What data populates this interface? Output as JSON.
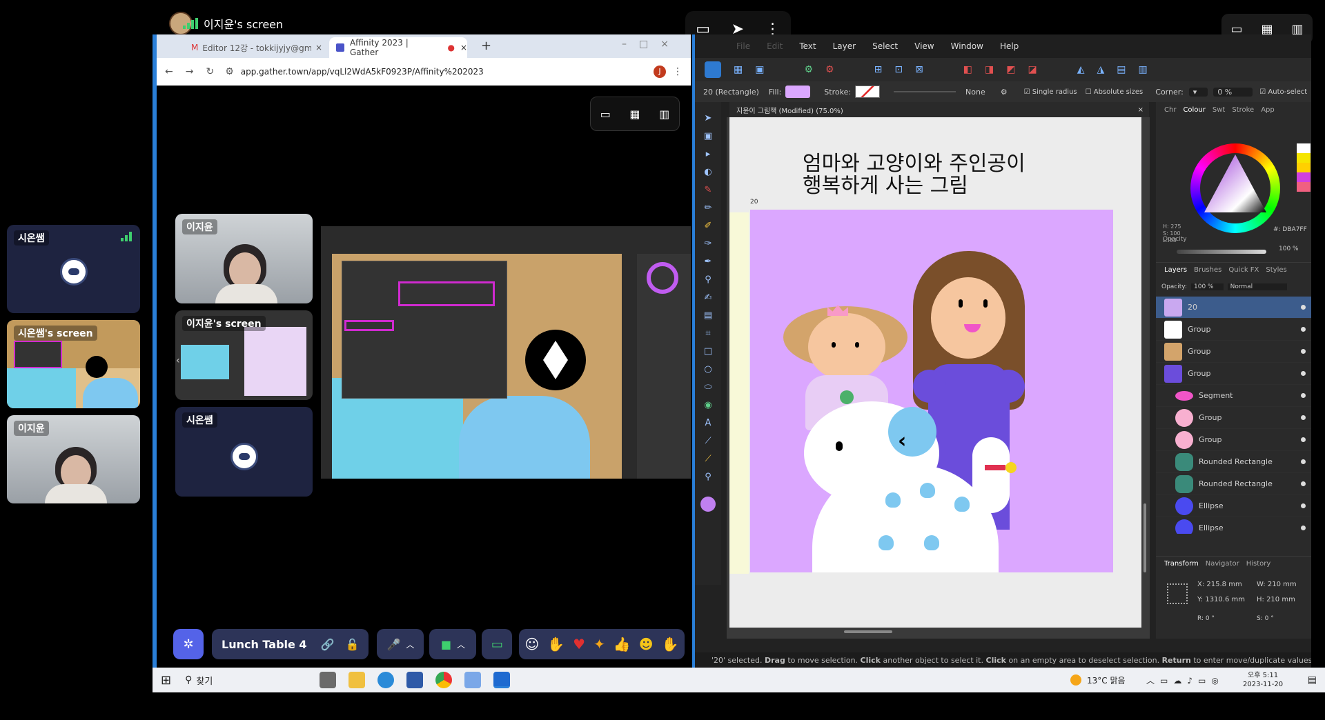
{
  "screen_share": {
    "owner": "이지윤's screen"
  },
  "sidebar": {
    "tiles": [
      {
        "name": "시온쌤"
      },
      {
        "name": "시온쌤's screen"
      },
      {
        "name": "이지윤"
      }
    ]
  },
  "browser": {
    "tabs": [
      {
        "label": "Editor 12강 - tokkijyjy@gmail..."
      },
      {
        "label": "Affinity 2023 | Gather"
      }
    ],
    "url": "app.gather.town/app/vqLl2WdA5kF0923P/Affinity%202023",
    "profile_initial": "J"
  },
  "gather": {
    "tiles": [
      {
        "name": "이지윤"
      },
      {
        "name": "이지윤's screen"
      },
      {
        "name": "시온쌤"
      }
    ],
    "toolbar": {
      "room": "Lunch Table 4"
    }
  },
  "affinity": {
    "menu": [
      "File",
      "Edit",
      "Text",
      "Layer",
      "Select",
      "View",
      "Window",
      "Help"
    ],
    "context": {
      "selection": "20 (Rectangle)",
      "fill_label": "Fill:",
      "stroke_label": "Stroke:",
      "none_label": "None",
      "single_radius": "Single radius",
      "absolute_sizes": "Absolute sizes",
      "corner_label": "Corner:",
      "corner_value": "0 %",
      "auto_select": "Auto-select"
    },
    "doc_title": "지윤이 그림책 (Modified) (75.0%)",
    "canvas_text_line1": "엄마와 고양이와 주인공이",
    "canvas_text_line2": "행복하게 사는 그림",
    "canvas_label": "20",
    "colour_panel": {
      "tabs": [
        "Chr",
        "Colour",
        "Swt",
        "Stroke",
        "App"
      ],
      "h": "H: 275",
      "s": "S: 100",
      "l": "L: 83",
      "hex": "#: DBA7FF",
      "opacity_label": "Opacity",
      "opacity_value": "100 %",
      "fill_color": "#DBA7FF"
    },
    "layers_panel": {
      "tabs": [
        "Layers",
        "Brushes",
        "Quick FX",
        "Styles"
      ],
      "opacity_label": "Opacity:",
      "opacity_value": "100 %",
      "blend": "Normal",
      "items": [
        "20",
        "Group",
        "Group",
        "Group",
        "Segment",
        "Group",
        "Group",
        "Rounded Rectangle",
        "Rounded Rectangle",
        "Ellipse",
        "Ellipse"
      ]
    },
    "transform_panel": {
      "tabs": [
        "Transform",
        "Navigator",
        "History"
      ],
      "x": "X: 215.8 mm",
      "y": "Y: 1310.6 mm",
      "w": "W: 210 mm",
      "h": "H: 210 mm",
      "r": "R: 0 °",
      "s": "S: 0 °"
    },
    "status_pre": "'20' selected.",
    "status_k1": "Drag",
    "status_t1": "to move selection.",
    "status_k2": "Click",
    "status_t2": "another object to select it.",
    "status_k3": "Click",
    "status_t3": "on an empty area to deselect selection.",
    "status_k4": "Return",
    "status_t4": "to enter move/duplicate values."
  },
  "taskbar": {
    "search": "찾기",
    "weather": "13°C 맑음",
    "time": "오후 5:11",
    "date": "2023-11-20"
  }
}
